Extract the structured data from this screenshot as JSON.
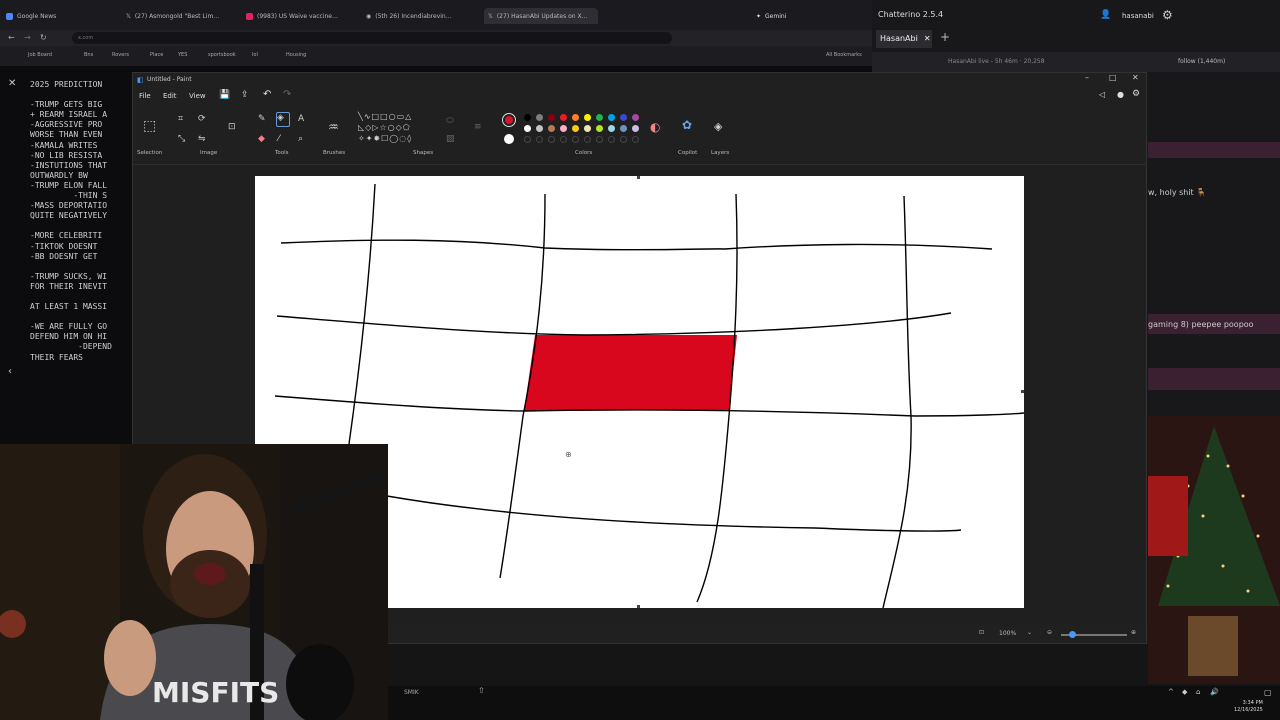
{
  "browser": {
    "tabs": [
      {
        "label": "Google News",
        "color": "#4a8af4"
      },
      {
        "label": "(27) Asmongold \"Best Lim…",
        "color": "#eeeeee"
      },
      {
        "label": "(9983) US Waive vaccine…",
        "color": "#e0245e"
      },
      {
        "label": "(5th 26) Incendiabrevin…",
        "color": "#eeeeee"
      },
      {
        "label": "(27) HasanAbi Updates on X…",
        "color": "#eeeeee"
      }
    ],
    "gemini_label": "Gemini",
    "url": "x.com",
    "bookmarks": [
      "Job Board",
      "Bns",
      "Rovers",
      "Place",
      "YES",
      "sportsbook",
      "lol",
      "Housing",
      "All Bookmarks"
    ]
  },
  "chat": {
    "app_title": "Chatterino 2.5.4",
    "user": "hasanabi",
    "tab_label": "HasanAbi",
    "viewer_line": "HasanAbi live - 5h 46m · 20,258",
    "follow_label": "follow (1,440m)",
    "messages": [
      {
        "text": "w, holy shit 🪑"
      },
      {
        "text": "gaming 8) peepee poopoo"
      }
    ]
  },
  "document": {
    "lines": [
      "2025 PREDICTION",
      "",
      "-TRUMP GETS BIG",
      "+ REARM ISRAEL A",
      "-AGGRESSIVE PRO",
      "WORSE THAN EVEN",
      "-KAMALA WRITES",
      "-NO LIB RESISTA",
      "-INSTUTIONS THAT",
      "OUTWARDLY BW",
      "-TRUMP ELON FALL",
      "         -THIN S",
      "-MASS DEPORTATIO",
      "QUITE NEGATIVELY",
      "",
      "-MORE CELEBRITI",
      "-TIKTOK DOESNT",
      "-BB DOESNT GET",
      "",
      "-TRUMP SUCKS, WI",
      "FOR THEIR INEVIT",
      "",
      "AT LEAST 1 MASSI",
      "",
      "-WE ARE FULLY GO",
      "DEFEND HIM ON HI",
      "          -DEPEND",
      "THEIR FEARS"
    ]
  },
  "paint": {
    "window_title": "Untitled - Paint",
    "menu": [
      "File",
      "Edit",
      "View"
    ],
    "groups": [
      "Selection",
      "Image",
      "Tools",
      "Brushes",
      "Shapes",
      "Colors",
      "Copilot",
      "Layers"
    ],
    "primary_color": "#d4142a",
    "secondary_color": "#ffffff",
    "palette_row1": [
      "#000000",
      "#7f7f7f",
      "#880015",
      "#ed1c24",
      "#ff7f27",
      "#fff200",
      "#22b14c",
      "#00a2e8",
      "#3f48cc",
      "#a349a4"
    ],
    "palette_row2": [
      "#ffffff",
      "#c3c3c3",
      "#b97a57",
      "#ffaec9",
      "#ffc90e",
      "#efe4b0",
      "#b5e61d",
      "#99d9ea",
      "#7092be",
      "#c8bfe7"
    ],
    "fill_color": "#d9071d",
    "zoom": "100%"
  },
  "taskbar": {
    "time": "3:34 PM",
    "date": "12/16/2025",
    "app_label": "SMIK"
  },
  "webcam": {
    "shirt_text": "MISFITS"
  }
}
